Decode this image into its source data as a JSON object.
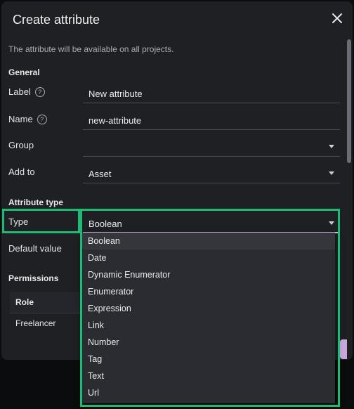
{
  "dialog": {
    "title": "Create attribute",
    "subtitle": "The attribute will be available on all projects.",
    "close_icon": "close-icon"
  },
  "general": {
    "heading": "General",
    "label_label": "Label",
    "label_value": "New attribute",
    "name_label": "Name",
    "name_value": "new-attribute",
    "group_label": "Group",
    "group_value": "",
    "addto_label": "Add to",
    "addto_value": "Asset"
  },
  "attribute_type": {
    "heading": "Attribute type",
    "type_label": "Type",
    "type_value": "Boolean",
    "default_label": "Default value"
  },
  "permissions": {
    "heading": "Permissions",
    "col_role": "Role",
    "rows": [
      "Freelancer"
    ]
  },
  "dropdown": {
    "options": [
      "Boolean",
      "Date",
      "Dynamic Enumerator",
      "Enumerator",
      "Expression",
      "Link",
      "Number",
      "Tag",
      "Text",
      "Url"
    ],
    "selected": "Boolean"
  },
  "colors": {
    "highlight": "#1dbb74",
    "accent": "#d9b8ea",
    "background": "#1e2024"
  }
}
